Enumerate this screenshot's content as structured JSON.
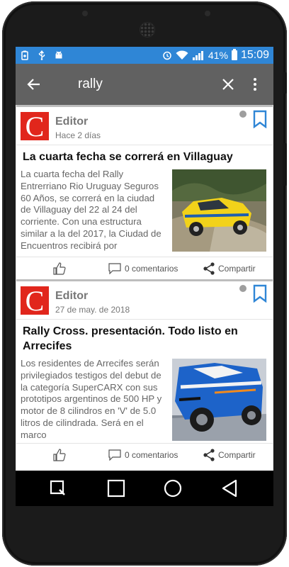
{
  "status_bar": {
    "battery_percent": "41%",
    "time": "15:09",
    "left_icons": [
      "battery-saver-icon",
      "usb-icon",
      "android-debug-icon"
    ],
    "right_icons": [
      "alarm-icon",
      "wifi-icon",
      "signal-icon",
      "battery-icon"
    ]
  },
  "toolbar": {
    "query": "rally",
    "back_icon": "arrow-back-icon",
    "clear_icon": "close-icon",
    "menu_icon": "more-vert-icon",
    "background": "#616161"
  },
  "articles": [
    {
      "logo_letter": "C",
      "author": "Editor",
      "date": "Hace 2 días",
      "title": "La cuarta fecha se correrá en Villaguay",
      "excerpt": "La cuarta fecha del Rally Entrerriano Rio Uruguay Seguros 60 Años, se correrá en la ciudad de Villaguay del 22 al 24 del corriente. Con una estructura similar a la del 2017, la Ciudad de Encuentros recibirá por",
      "comments": "0 comentarios",
      "share": "Compartir"
    },
    {
      "logo_letter": "C",
      "author": "Editor",
      "date": "27 de may. de 2018",
      "title": "Rally Cross. presentación. Todo listo en Arrecifes",
      "excerpt": "Los residentes de Arrecifes serán privilegiados testigos del debut de la categoría SuperCARX con sus prototipos argentinos de 500 HP y motor de 8 cilindros en 'V' de 5.0 litros de cilindrada. Será en el marco",
      "comments": "0 comentarios",
      "share": "Compartir"
    }
  ],
  "colors": {
    "status_bar": "#2f86d6",
    "logo_red": "#e1261c",
    "bookmark_blue": "#2f86d6"
  },
  "nav_icons": [
    "recents-search-icon",
    "home-square-icon",
    "circle-home-icon",
    "back-triangle-icon"
  ]
}
